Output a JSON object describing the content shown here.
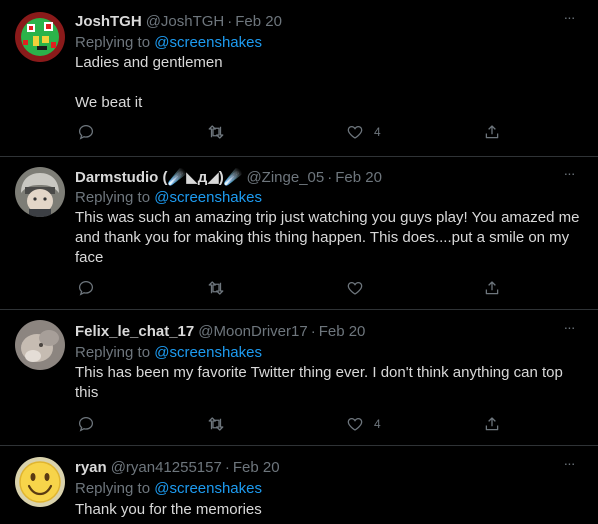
{
  "tweets": [
    {
      "name": "JoshTGH",
      "handle": "@JoshTGH",
      "date": "Feb 20",
      "replying_prefix": "Replying to",
      "replying_to": "@screenshakes",
      "body": "Ladies and gentlemen\n\nWe beat it",
      "likes": "4",
      "avatar_icon": "pixel-art-avatar"
    },
    {
      "name": "Darmstudio (☄️◣д◢)☄️",
      "handle": "@Zinge_05",
      "date": "Feb 20",
      "replying_prefix": "Replying to",
      "replying_to": "@screenshakes",
      "body": "This was such an amazing trip just watching you guys play! You amazed me and thank you for making this thing happen. This does....put a smile on my face",
      "likes": "",
      "avatar_icon": "anime-avatar"
    },
    {
      "name": "Felix_le_chat_17",
      "handle": "@MoonDriver17",
      "date": "Feb 20",
      "replying_prefix": "Replying to",
      "replying_to": "@screenshakes",
      "body": "This has been my favorite Twitter thing ever. I don't think anything can top this",
      "likes": "4",
      "avatar_icon": "photo-avatar"
    },
    {
      "name": "ryan",
      "handle": "@ryan41255157",
      "date": "Feb 20",
      "replying_prefix": "Replying to",
      "replying_to": "@screenshakes",
      "body": "Thank you for the memories",
      "likes": "",
      "avatar_icon": "smiley-avatar"
    }
  ],
  "more_label": "···",
  "separator": "·",
  "colors": {
    "background": "#000000",
    "text": "#d9d9d9",
    "muted": "#6e767d",
    "accent": "#1d9bf0",
    "divider": "#2f3336"
  }
}
